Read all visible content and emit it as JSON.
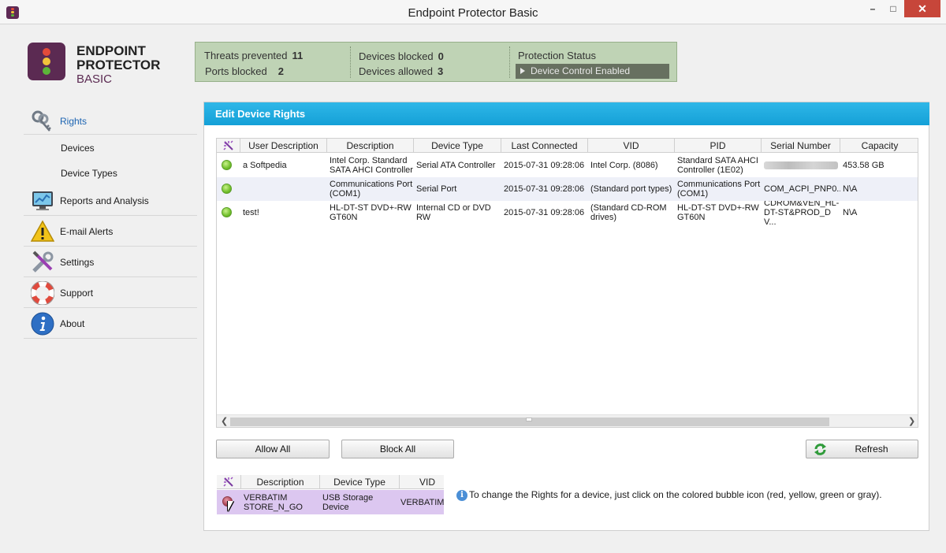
{
  "window": {
    "title": "Endpoint Protector Basic",
    "min": "–",
    "max": "□",
    "close": "✕"
  },
  "logo": {
    "line1": "ENDPOINT",
    "line2": "PROTECTOR",
    "line3": "BASIC"
  },
  "stats": {
    "threats_label": "Threats prevented",
    "threats_value": "11",
    "ports_label": "Ports blocked",
    "ports_value": "2",
    "blocked_label": "Devices blocked",
    "blocked_value": "0",
    "allowed_label": "Devices allowed",
    "allowed_value": "3",
    "protection_label": "Protection Status",
    "protection_value": "Device Control Enabled"
  },
  "nav": {
    "rights": "Rights",
    "devices": "Devices",
    "device_types": "Device Types",
    "reports": "Reports and Analysis",
    "alerts": "E-mail Alerts",
    "settings": "Settings",
    "support": "Support",
    "about": "About"
  },
  "panel": {
    "title": "Edit Device Rights"
  },
  "grid": {
    "columns": [
      "User Description",
      "Description",
      "Device Type",
      "Last Connected",
      "VID",
      "PID",
      "Serial Number",
      "Capacity"
    ],
    "rows": [
      [
        "a Softpedia",
        "Intel Corp. Standard SATA AHCI Controller",
        "Serial ATA Controller",
        "2015-07-31 09:28:06",
        "Intel Corp. (8086)",
        "Standard SATA AHCI Controller (1E02)",
        "",
        "453.58 GB"
      ],
      [
        "",
        "Communications Port (COM1)",
        "Serial Port",
        "2015-07-31 09:28:06",
        "(Standard port types)",
        "Communications Port (COM1)",
        "COM_ACPI_PNP0...",
        "N\\A"
      ],
      [
        "test!",
        "HL-DT-ST DVD+-RW GT60N",
        "Internal CD or DVD RW",
        "2015-07-31 09:28:06",
        "(Standard CD-ROM drives)",
        "HL-DT-ST DVD+-RW GT60N",
        "CDROM&VEN_HL-DT-ST&PROD_DV...",
        "N\\A"
      ]
    ]
  },
  "buttons": {
    "allow_all": "Allow All",
    "block_all": "Block All",
    "refresh": "Refresh"
  },
  "mini_grid": {
    "columns": [
      "Description",
      "Device Type",
      "VID"
    ],
    "row": [
      "VERBATIM STORE_N_GO",
      "USB Storage Device",
      "VERBATIM"
    ]
  },
  "hint": "To change the Rights for a device, just click on the colored bubble icon (red, yellow, green or gray).",
  "colors": {
    "accent": "#1ba8dc",
    "stats_bg": "#bfd3b5",
    "brand": "#5b2a52",
    "selected_row": "#dcc7f0"
  }
}
